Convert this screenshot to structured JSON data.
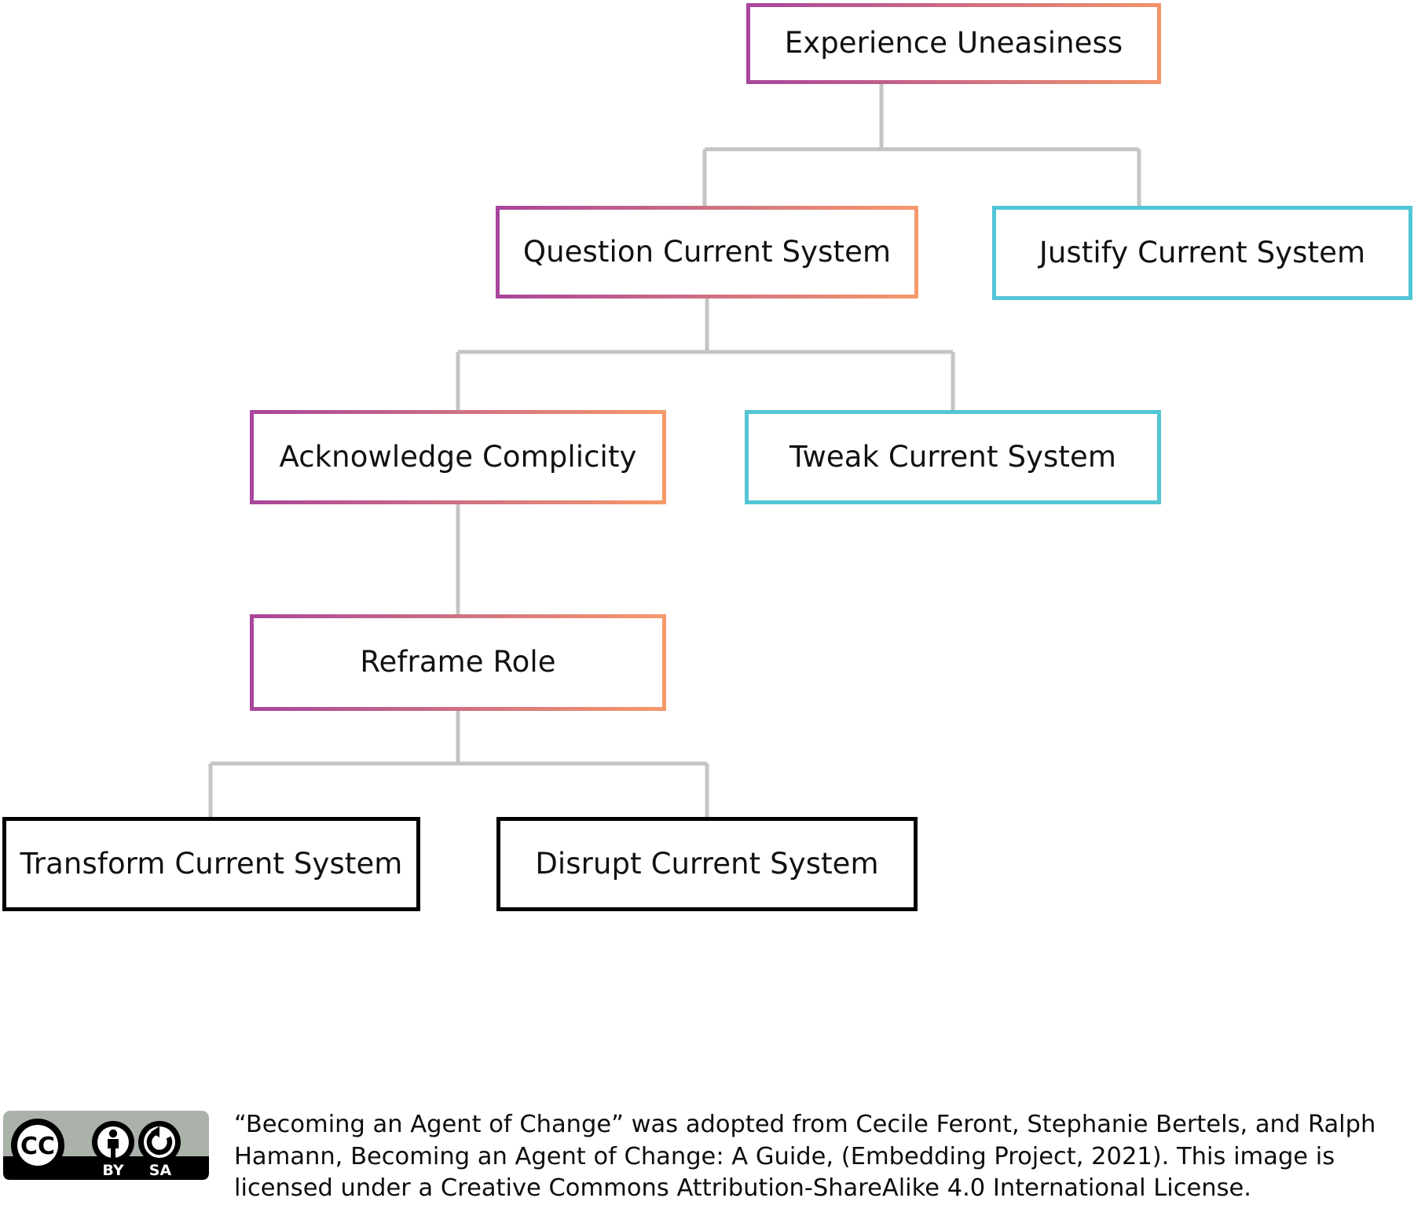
{
  "diagram": {
    "title": "Becoming an Agent of Change",
    "colors": {
      "gradient_start": "#a8459c",
      "gradient_end": "#f59a6a",
      "teal": "#52c6d4",
      "black": "#000000",
      "connector": "#c4c4c4"
    },
    "nodes": [
      {
        "id": "experience-uneasiness",
        "label": "Experience Uneasiness",
        "style": "gradient"
      },
      {
        "id": "question-current-system",
        "label": "Question Current System",
        "style": "gradient"
      },
      {
        "id": "justify-current-system",
        "label": "Justify Current System",
        "style": "teal"
      },
      {
        "id": "acknowledge-complicity",
        "label": "Acknowledge Complicity",
        "style": "gradient"
      },
      {
        "id": "tweak-current-system",
        "label": "Tweak Current System",
        "style": "teal"
      },
      {
        "id": "reframe-role",
        "label": "Reframe Role",
        "style": "gradient"
      },
      {
        "id": "transform-current-system",
        "label": "Transform Current System",
        "style": "black"
      },
      {
        "id": "disrupt-current-system",
        "label": "Disrupt Current System",
        "style": "black"
      }
    ],
    "edges": [
      {
        "from": "experience-uneasiness",
        "to": "question-current-system"
      },
      {
        "from": "experience-uneasiness",
        "to": "justify-current-system"
      },
      {
        "from": "question-current-system",
        "to": "acknowledge-complicity"
      },
      {
        "from": "question-current-system",
        "to": "tweak-current-system"
      },
      {
        "from": "acknowledge-complicity",
        "to": "reframe-role"
      },
      {
        "from": "reframe-role",
        "to": "transform-current-system"
      },
      {
        "from": "reframe-role",
        "to": "disrupt-current-system"
      }
    ]
  },
  "license": {
    "badge_cc": "CC",
    "badge_by": "BY",
    "badge_sa": "SA",
    "text": "“Becoming an Agent of Change” was adopted from Cecile Feront, Stephanie Bertels, and Ralph Hamann, Becoming an Agent of Change: A Guide, (Embedding Project, 2021). This image is licensed under a Creative Commons Attribution-ShareAlike 4.0 International License."
  }
}
